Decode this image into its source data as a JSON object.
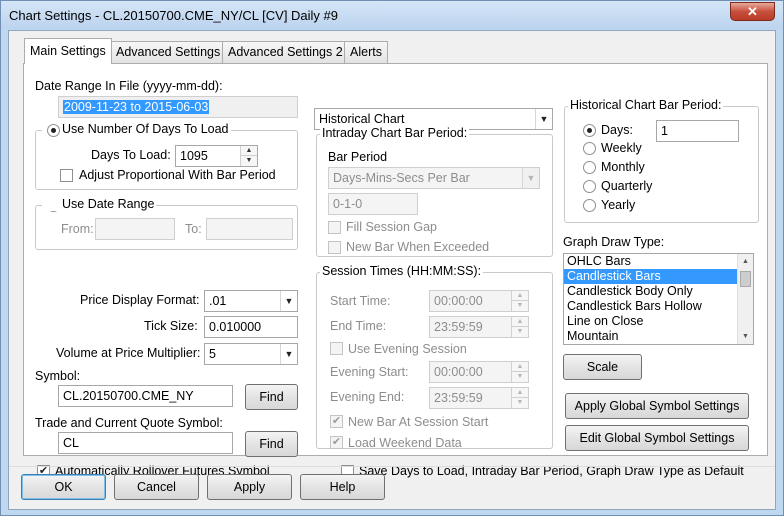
{
  "window": {
    "title": "Chart Settings - CL.20150700.CME_NY/CL [CV]  Daily  #9",
    "close_glyph": "✕"
  },
  "tabs": [
    "Main Settings",
    "Advanced Settings",
    "Advanced Settings 2",
    "Alerts"
  ],
  "left": {
    "date_range_label": "Date Range In File (yyyy-mm-dd):",
    "date_range_value": "2009-11-23 to 2015-06-03",
    "use_days_label": "Use Number Of Days To Load",
    "days_to_load_label": "Days To Load:",
    "days_to_load_value": "1095",
    "adjust_label": "Adjust Proportional With Bar Period",
    "use_date_range_label": "Use Date Range",
    "from_label": "From:",
    "to_label": "To:",
    "price_format_label": "Price Display Format:",
    "price_format_value": ".01",
    "tick_size_label": "Tick Size:",
    "tick_size_value": "0.010000",
    "vap_label": "Volume at Price Multiplier:",
    "vap_value": "5",
    "symbol_label": "Symbol:",
    "symbol_value": "CL.20150700.CME_NY",
    "find_label": "Find",
    "trade_symbol_label": "Trade and Current Quote Symbol:",
    "trade_symbol_value": "CL",
    "rollover_label": "Automatically Rollover Futures Symbol"
  },
  "middle": {
    "chart_type_value": "Historical Chart",
    "intraday_group_title": "Intraday Chart Bar Period:",
    "bar_period_label": "Bar Period",
    "bar_period_type": "Days-Mins-Secs Per Bar",
    "bar_period_value": "0-1-0",
    "fill_session_gap_label": "Fill Session Gap",
    "new_bar_exceeded_label": "New Bar When Exceeded",
    "session_group_title": "Session Times (HH:MM:SS):",
    "start_time_label": "Start Time:",
    "start_time_value": "00:00:00",
    "end_time_label": "End Time:",
    "end_time_value": "23:59:59",
    "use_evening_label": "Use Evening Session",
    "evening_start_label": "Evening Start:",
    "evening_start_value": "00:00:00",
    "evening_end_label": "Evening End:",
    "evening_end_value": "23:59:59",
    "new_bar_session_label": "New Bar At Session Start",
    "load_weekend_label": "Load Weekend Data"
  },
  "right": {
    "hist_group_title": "Historical Chart Bar Period:",
    "period_options": [
      "Days:",
      "Weekly",
      "Monthly",
      "Quarterly",
      "Yearly"
    ],
    "days_value": "1",
    "graph_draw_label": "Graph Draw Type:",
    "draw_types": [
      "OHLC Bars",
      "Candlestick Bars",
      "Candlestick Body Only",
      "Candlestick Bars Hollow",
      "Line on Close",
      "Mountain"
    ],
    "selected_draw_type": "Candlestick Bars",
    "scale_label": "Scale",
    "apply_global_label": "Apply Global Symbol Settings",
    "edit_global_label": "Edit Global Symbol Settings"
  },
  "save_default_label": "Save Days to Load, Intraday Bar Period, Graph Draw Type as Default",
  "footer": {
    "ok": "OK",
    "cancel": "Cancel",
    "apply": "Apply",
    "help": "Help"
  }
}
